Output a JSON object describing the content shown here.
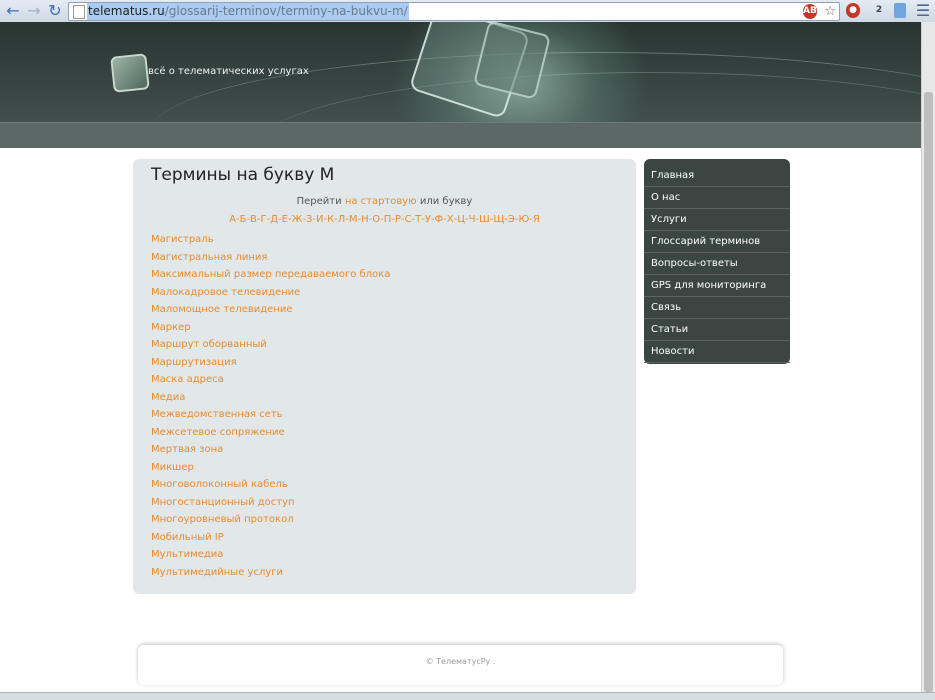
{
  "browser": {
    "url_host": "telematus.ru",
    "url_path": "/glossarij-terminov/terminy-na-bukvu-m/",
    "extensions": [
      "ABP",
      "2"
    ]
  },
  "header": {
    "tagline": "всё о телематических услугах"
  },
  "content": {
    "title": "Термины на букву М",
    "goto_prefix": "Перейти",
    "goto_link1": "на",
    "goto_link2": "стартовую",
    "goto_suffix": "или букву",
    "letters": "А-Б-В-Г-Д-Е-Ж-З-И-К-Л-М-Н-О-П-Р-С-Т-У-Ф-Х-Ц-Ч-Ш-Щ-Э-Ю-Я",
    "terms": [
      "Магистраль",
      "Магистральная линия",
      "Максимальный размер передаваемого блока",
      "Малокадровое телевидение",
      "Маломощное телевидение",
      "Маркер",
      "Маршрут оборванный",
      "Маршрутизация",
      "Маска адреса",
      "Медиа",
      "Межведомственная сеть",
      "Межсетевое сопряжение",
      "Мертвая зона",
      "Микшер",
      "Многоволоконный кабель",
      "Многостанционный доступ",
      "Многоуровневый протокол",
      "Мобильный IP",
      "Мультимедиа",
      "Мультимедийные услуги"
    ]
  },
  "menu": [
    "Главная",
    "О нас",
    "Услуги",
    "Глоссарий терминов",
    "Вопросы-ответы",
    "GPS для мониторинга",
    "Связь",
    "Статьи",
    "Новости"
  ],
  "footer": {
    "copyright": "© ТелематусРу ."
  },
  "colors": {
    "link": "#e88a2b",
    "header_dark": "#2a3532",
    "menu_bg": "#3b4542",
    "content_bg": "#e2e8e9"
  }
}
